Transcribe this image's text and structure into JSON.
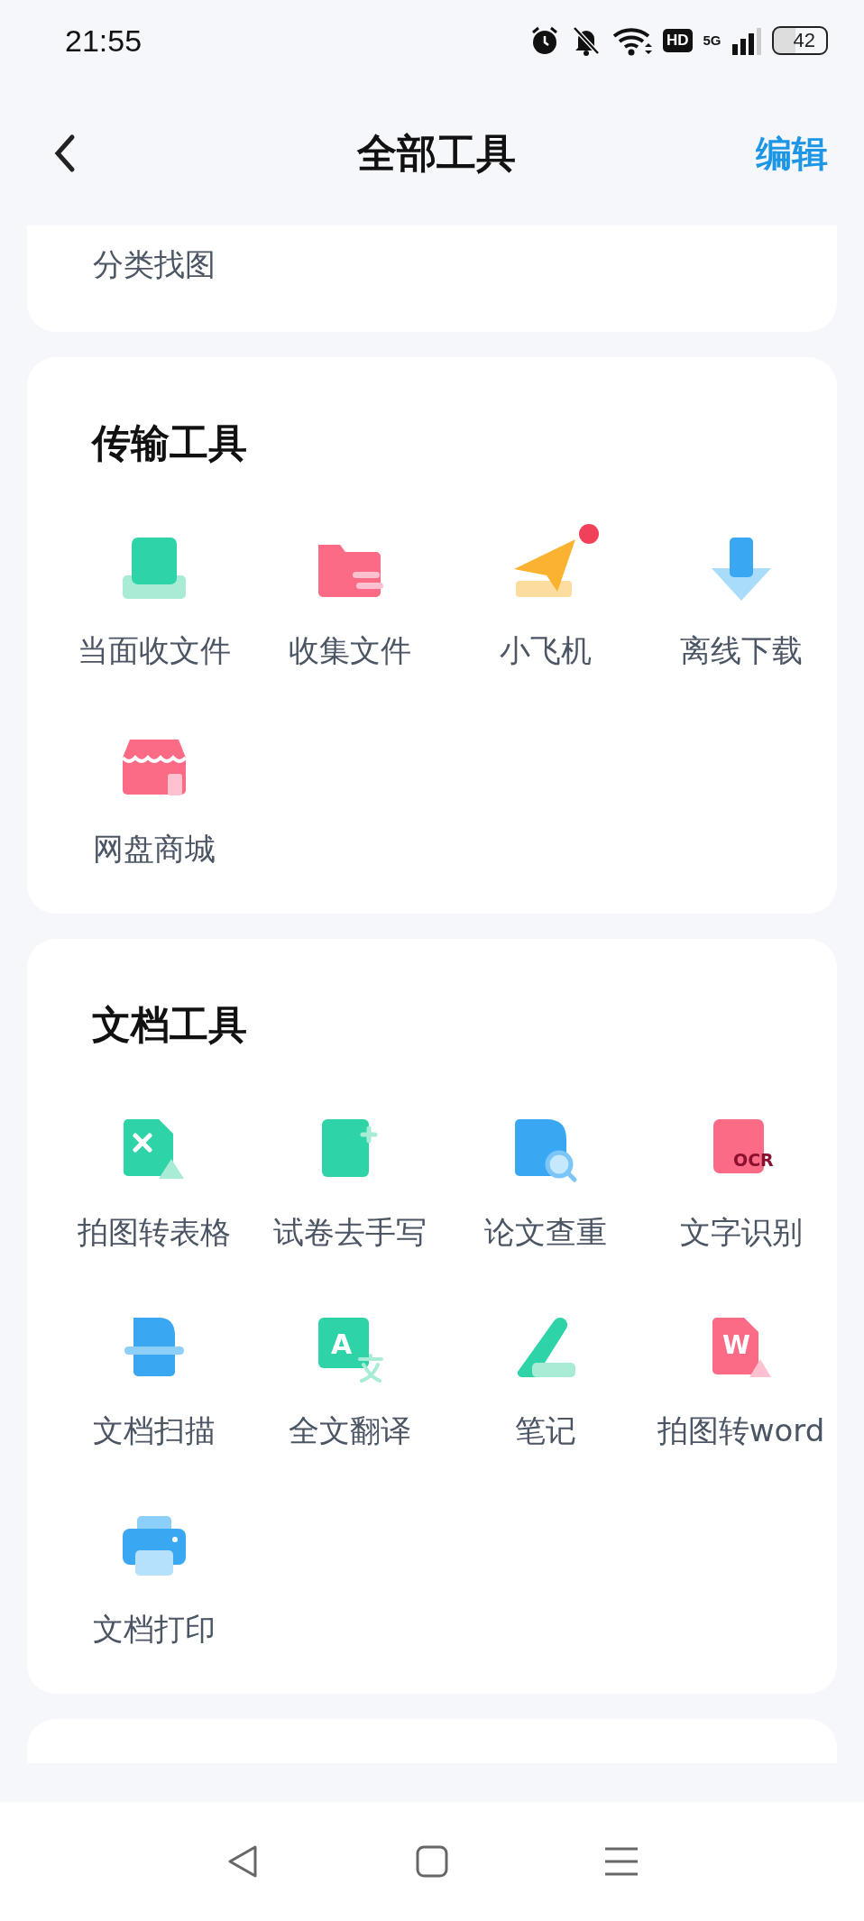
{
  "status_bar": {
    "time": "21:55",
    "hd": "HD",
    "network": "5G",
    "battery": "42"
  },
  "header": {
    "title": "全部工具",
    "action": "编辑"
  },
  "sections": [
    {
      "tools": [
        {
          "label": "分类找图"
        }
      ]
    },
    {
      "title": "传输工具",
      "tools": [
        {
          "label": "当面收文件",
          "badge": false
        },
        {
          "label": "收集文件",
          "badge": false
        },
        {
          "label": "小飞机",
          "badge": true
        },
        {
          "label": "离线下载",
          "badge": false
        },
        {
          "label": "网盘商城",
          "badge": false
        }
      ]
    },
    {
      "title": "文档工具",
      "tools": [
        {
          "label": "拍图转表格",
          "badge": false
        },
        {
          "label": "试卷去手写",
          "badge": false
        },
        {
          "label": "论文查重",
          "badge": false
        },
        {
          "label": "文字识别",
          "glyph": "OCR",
          "badge": false
        },
        {
          "label": "文档扫描",
          "badge": false
        },
        {
          "label": "全文翻译",
          "glyph": "A",
          "badge": false
        },
        {
          "label": "笔记",
          "badge": false
        },
        {
          "label": "拍图转word",
          "glyph": "W",
          "badge": false
        },
        {
          "label": "文档打印",
          "badge": false
        }
      ]
    }
  ]
}
